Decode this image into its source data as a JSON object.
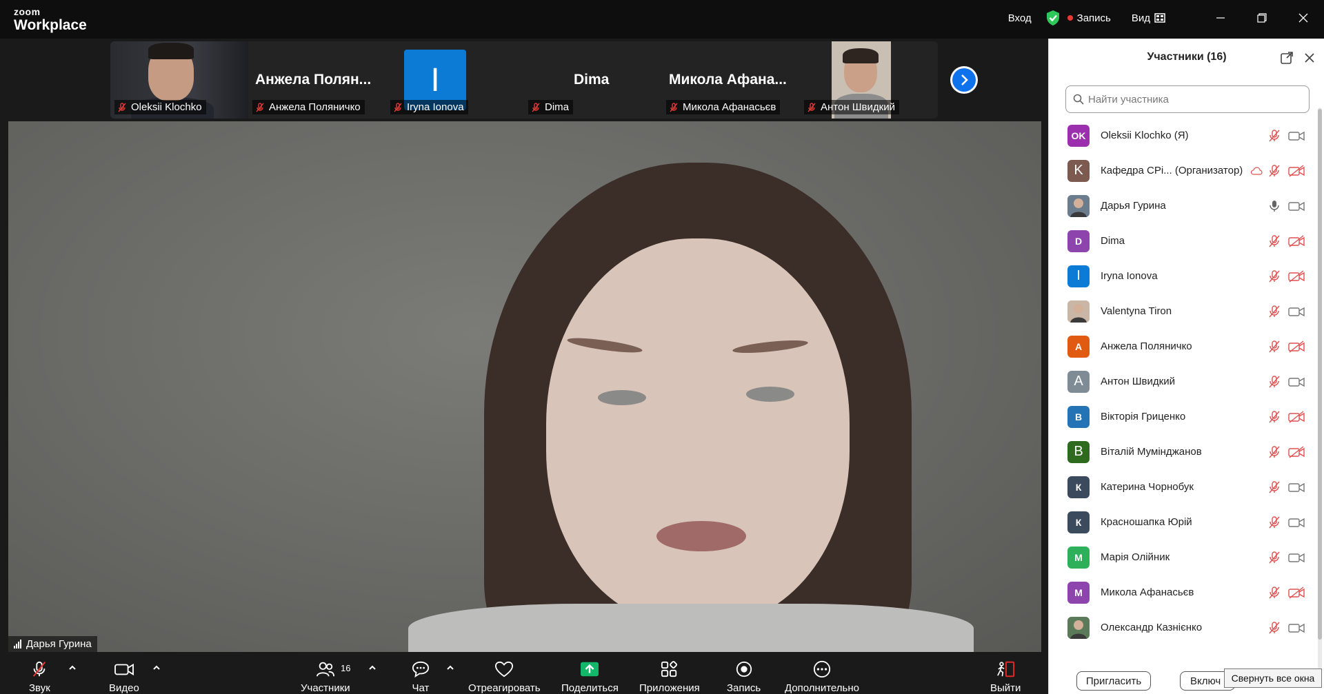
{
  "app": {
    "logo_top": "zoom",
    "logo_bottom": "Workplace"
  },
  "topbar": {
    "login": "Вход",
    "record": "Запись",
    "view": "Вид"
  },
  "strip": {
    "tiles": [
      {
        "name": "Oleksii Klochko",
        "kind": "video"
      },
      {
        "name": "Анжела Поляничко",
        "big": "Анжела  Полян..."
      },
      {
        "name": "Iryna Ionova",
        "letter": "I"
      },
      {
        "name": "Dima",
        "big": "Dima"
      },
      {
        "name": "Микола Афанасьєв",
        "big": "Микола  Афана..."
      },
      {
        "name": "Антон Швидкий",
        "kind": "video"
      }
    ]
  },
  "main_video": {
    "speaker": "Дарья Гурина"
  },
  "toolbar": {
    "audio": "Звук",
    "video": "Видео",
    "participants": "Участники",
    "participants_count": "16",
    "chat": "Чат",
    "react": "Отреагировать",
    "share": "Поделиться",
    "apps": "Приложения",
    "record": "Запись",
    "more": "Дополнительно",
    "leave": "Выйти",
    "share_color": "#12b76a",
    "leave_color": "#e02828"
  },
  "panel": {
    "title": "Участники (16)",
    "search_placeholder": "Найти участника",
    "invite": "Пригласить",
    "enable_truncated": "Включ",
    "tooltip": "Свернуть все окна",
    "participants": [
      {
        "name": "Oleksii Klochko (Я)",
        "initials": "OK",
        "color": "#9b2fae",
        "mic": "muted",
        "cam": "on"
      },
      {
        "name": "Кафедра СРі... (Организатор)",
        "initials": "K",
        "color": "#7d5a50",
        "mic": "muted",
        "cam": "off",
        "cloud": true
      },
      {
        "name": "Дарья Гурина",
        "initials": "",
        "color": "#6b7d8c",
        "mic": "on",
        "cam": "on",
        "photo": true
      },
      {
        "name": "Dima",
        "initials": "D",
        "color": "#8e44ad",
        "mic": "muted",
        "cam": "off"
      },
      {
        "name": "Iryna Ionova",
        "initials": "I",
        "color": "#0b7bd6",
        "mic": "muted",
        "cam": "off"
      },
      {
        "name": "Valentyna Tiron",
        "initials": "",
        "color": "#c9b6a6",
        "mic": "muted",
        "cam": "on",
        "photo": true
      },
      {
        "name": "Анжела Поляничко",
        "initials": "А",
        "color": "#e05a12",
        "mic": "muted",
        "cam": "off"
      },
      {
        "name": "Антон Швидкий",
        "initials": "A",
        "color": "#7f8c95",
        "mic": "muted",
        "cam": "on"
      },
      {
        "name": "Вікторія Гриценко",
        "initials": "В",
        "color": "#2474b5",
        "mic": "muted",
        "cam": "off"
      },
      {
        "name": "Віталій Мумінджанов",
        "initials": "B",
        "color": "#2e6b1f",
        "mic": "muted",
        "cam": "off"
      },
      {
        "name": "Катерина Чорнобук",
        "initials": "К",
        "color": "#3b4a5c",
        "mic": "muted",
        "cam": "on"
      },
      {
        "name": "Красношапка Юрій",
        "initials": "К",
        "color": "#3b4a5c",
        "mic": "muted",
        "cam": "on"
      },
      {
        "name": "Марія Олійник",
        "initials": "М",
        "color": "#2eb05a",
        "mic": "muted",
        "cam": "on"
      },
      {
        "name": "Микола Афанасьєв",
        "initials": "М",
        "color": "#8e44ad",
        "mic": "muted",
        "cam": "off"
      },
      {
        "name": "Олександр Казнієнко",
        "initials": "",
        "color": "#5a7a5a",
        "mic": "muted",
        "cam": "on",
        "photo": true
      }
    ]
  }
}
